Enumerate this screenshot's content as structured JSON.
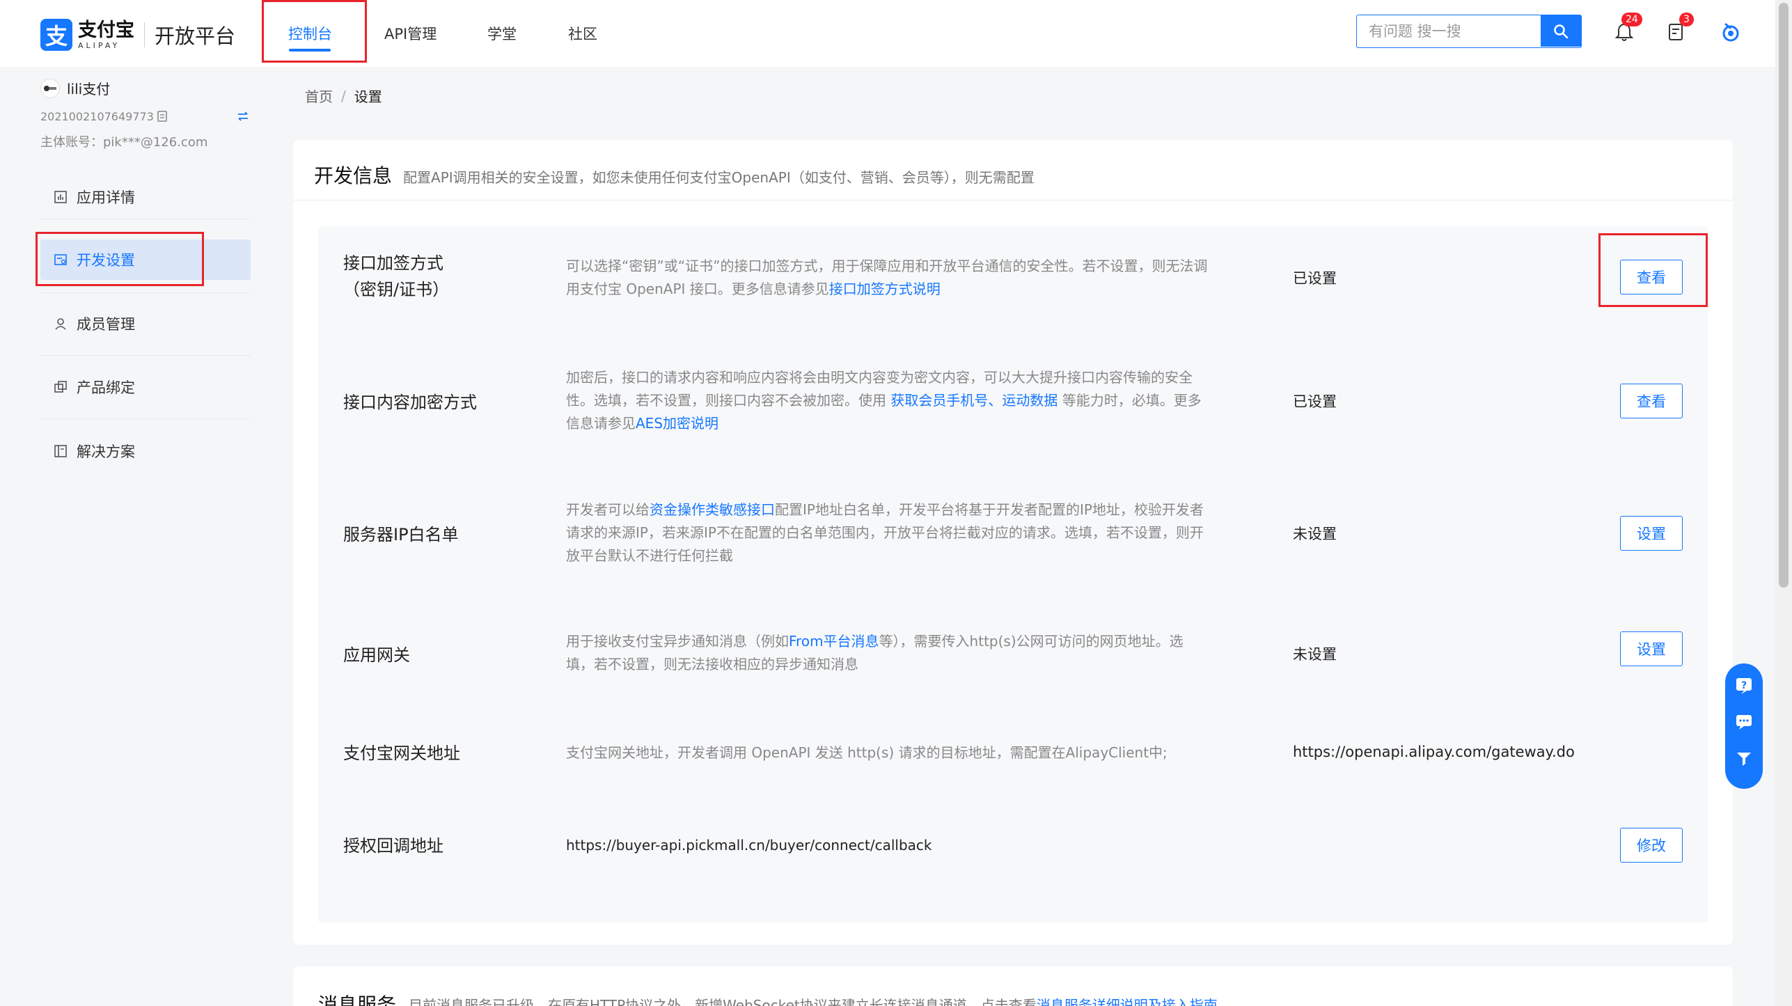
{
  "header": {
    "logo_cn": "支付宝",
    "logo_en": "ALIPAY",
    "platform": "开放平台",
    "nav": [
      "控制台",
      "API管理",
      "学堂",
      "社区"
    ],
    "search_placeholder": "有问题 搜一搜",
    "notif_badge": "24",
    "task_badge": "3"
  },
  "sidebar": {
    "account_name": "lili支付",
    "app_id": "2021002107649773",
    "main_account": "主体账号：pik***@126.com",
    "menu": [
      "应用详情",
      "开发设置",
      "成员管理",
      "产品绑定",
      "解决方案"
    ]
  },
  "breadcrumb": {
    "home": "首页",
    "sep": "/",
    "current": "设置"
  },
  "dev_info": {
    "title": "开发信息",
    "desc": "配置API调用相关的安全设置，如您未使用任何支付宝OpenAPI（如支付、营销、会员等），则无需配置",
    "rows": [
      {
        "label_1": "接口加签方式",
        "label_2": "（密钥/证书）",
        "desc_1": "可以选择“密钥”或“证书”的接口加签方式，用于保障应用和开放平台通信的安全性。若不设置，则无法调",
        "desc_2a": "用支付宝 OpenAPI 接口。更多信息请参见",
        "desc_2_link": "接口加签方式说明",
        "status": "已设置",
        "button": "查看"
      },
      {
        "label": "接口内容加密方式",
        "desc_1": "加密后，接口的请求内容和响应内容将会由明文内容变为密文内容，可以大大提升接口内容传输的安全",
        "desc_2a": "性。选填，若不设置，则接口内容不会被加密。使用 ",
        "desc_2_link1": "获取会员手机号",
        "desc_2_mid": "、",
        "desc_2_link2": "运动数据",
        "desc_2b": " 等能力时，必填。更多",
        "desc_3a": "信息请参见",
        "desc_3_link": "AES加密说明",
        "status": "已设置",
        "button": "查看"
      },
      {
        "label": "服务器IP白名单",
        "desc_1a": "开发者可以给",
        "desc_1_link": "资金操作类敏感接口",
        "desc_1b": "配置IP地址白名单，开发平台将基于开发者配置的IP地址，校验开发者",
        "desc_2": "请求的来源IP，若来源IP不在配置的白名单范围内，开放平台将拦截对应的请求。选填，若不设置，则开",
        "desc_3": "放平台默认不进行任何拦截",
        "status": "未设置",
        "button": "设置"
      },
      {
        "label": "应用网关",
        "desc_1a": "用于接收支付宝异步通知消息（例如",
        "desc_1_link": "From平台消息",
        "desc_1b": "等），需要传入http(s)公网可访问的网页地址。选",
        "desc_2": "填，若不设置，则无法接收相应的异步通知消息",
        "status": "未设置",
        "button": "设置"
      },
      {
        "label": "支付宝网关地址",
        "desc": "支付宝网关地址，开发者调用 OpenAPI 发送 http(s) 请求的目标地址，需配置在AlipayClient中;",
        "value": "https://openapi.alipay.com/gateway.do"
      },
      {
        "label": "授权回调地址",
        "value": "https://buyer-api.pickmall.cn/buyer/connect/callback",
        "button": "修改"
      }
    ]
  },
  "message_service": {
    "title": "消息服务",
    "desc_a": "目前消息服务已升级，在原有HTTP协议之外，新增WebSocket协议来建立长连接消息通道，点击查看",
    "desc_link": "消息服务详细说明及接入指南"
  },
  "colors": {
    "accent": "#1677ff",
    "highlight": "#e8242c",
    "badge": "#f5222d"
  }
}
